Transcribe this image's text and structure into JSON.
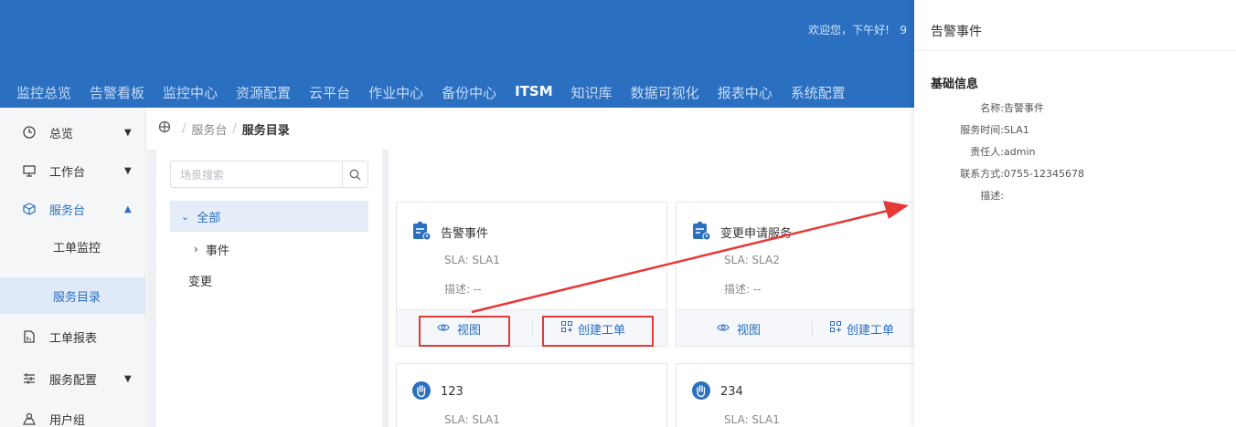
{
  "header": {
    "greeting": "欢迎您，下午好!",
    "greeting_trail": "9",
    "nav": [
      "监控总览",
      "告警看板",
      "监控中心",
      "资源配置",
      "云平台",
      "作业中心",
      "备份中心",
      "ITSM",
      "知识库",
      "数据可视化",
      "报表中心",
      "系统配置"
    ],
    "active_nav": "ITSM"
  },
  "sidebar": {
    "items": [
      {
        "label": "总览",
        "icon": "clock-icon"
      },
      {
        "label": "工作台",
        "icon": "monitor-icon"
      },
      {
        "label": "服务台",
        "icon": "cube-icon"
      },
      {
        "label": "工单报表",
        "icon": "report-icon"
      },
      {
        "label": "服务配置",
        "icon": "sliders-icon"
      },
      {
        "label": "用户组",
        "icon": "users-icon"
      }
    ],
    "sub_items": [
      "工单监控",
      "服务目录"
    ]
  },
  "breadcrumb": {
    "parent": "服务台",
    "current": "服务目录"
  },
  "tree": {
    "search_placeholder": "场景搜索",
    "root": "全部",
    "child": "事件",
    "other": "变更"
  },
  "cards": [
    {
      "title": "告警事件",
      "sla": "SLA: SLA1",
      "desc": "描述: --",
      "view": "视图",
      "create": "创建工单"
    },
    {
      "title": "变更申请服务",
      "sla": "SLA: SLA2",
      "desc": "描述: --",
      "view": "视图",
      "create": "创建工单"
    },
    {
      "title": "123",
      "sla": "SLA: SLA1"
    },
    {
      "title": "234",
      "sla": "SLA: SLA1"
    }
  ],
  "panel": {
    "title": "告警事件",
    "section": "基础信息",
    "fields": [
      {
        "label": "名称:",
        "value": "告警事件"
      },
      {
        "label": "服务时间:",
        "value": "SLA1"
      },
      {
        "label": "责任人:",
        "value": "admin"
      },
      {
        "label": "联系方式:",
        "value": "0755-12345678"
      },
      {
        "label": "描述:",
        "value": ""
      }
    ]
  },
  "colors": {
    "primary": "#2a6fc0",
    "annotation": "#e53935"
  }
}
